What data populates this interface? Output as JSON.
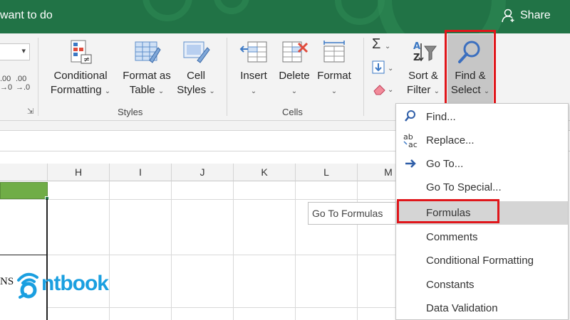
{
  "titlebar": {
    "tell_me": "want to do",
    "share": "Share"
  },
  "ribbon": {
    "number_decimals": {
      "increase": ".00",
      "increase_sub": "→0",
      "decrease": ".00",
      "decrease_sub": "→.0"
    },
    "styles": {
      "conditional_formatting": [
        "Conditional",
        "Formatting"
      ],
      "format_as_table": [
        "Format as",
        "Table"
      ],
      "cell_styles": [
        "Cell",
        "Styles"
      ],
      "group_label": "Styles"
    },
    "cells": {
      "insert": "Insert",
      "delete": "Delete",
      "format": "Format",
      "group_label": "Cells"
    },
    "editing": {
      "sort_filter": [
        "Sort &",
        "Filter"
      ],
      "find_select": [
        "Find &",
        "Select"
      ]
    }
  },
  "grid": {
    "columns": [
      "H",
      "I",
      "J",
      "K",
      "L",
      "M"
    ],
    "cell_text": "NS"
  },
  "tooltip": "Go To Formulas",
  "menu": {
    "items": [
      {
        "label": "Find...",
        "icon": "search-icon"
      },
      {
        "label": "Replace...",
        "icon": "replace-icon"
      },
      {
        "label": "Go To...",
        "icon": "arrow-right-icon"
      },
      {
        "label": "Go To Special...",
        "icon": ""
      },
      {
        "label": "Formulas",
        "icon": "",
        "highlighted": true
      },
      {
        "label": "Comments",
        "icon": ""
      },
      {
        "label": "Conditional Formatting",
        "icon": ""
      },
      {
        "label": "Constants",
        "icon": ""
      },
      {
        "label": "Data Validation",
        "icon": ""
      }
    ]
  },
  "logo": {
    "text": "ntbook"
  },
  "colors": {
    "excel_green": "#217346",
    "highlight_red": "#e0161b",
    "logo_blue": "#1a9fe0",
    "selected_cell_green": "#70ad47"
  }
}
